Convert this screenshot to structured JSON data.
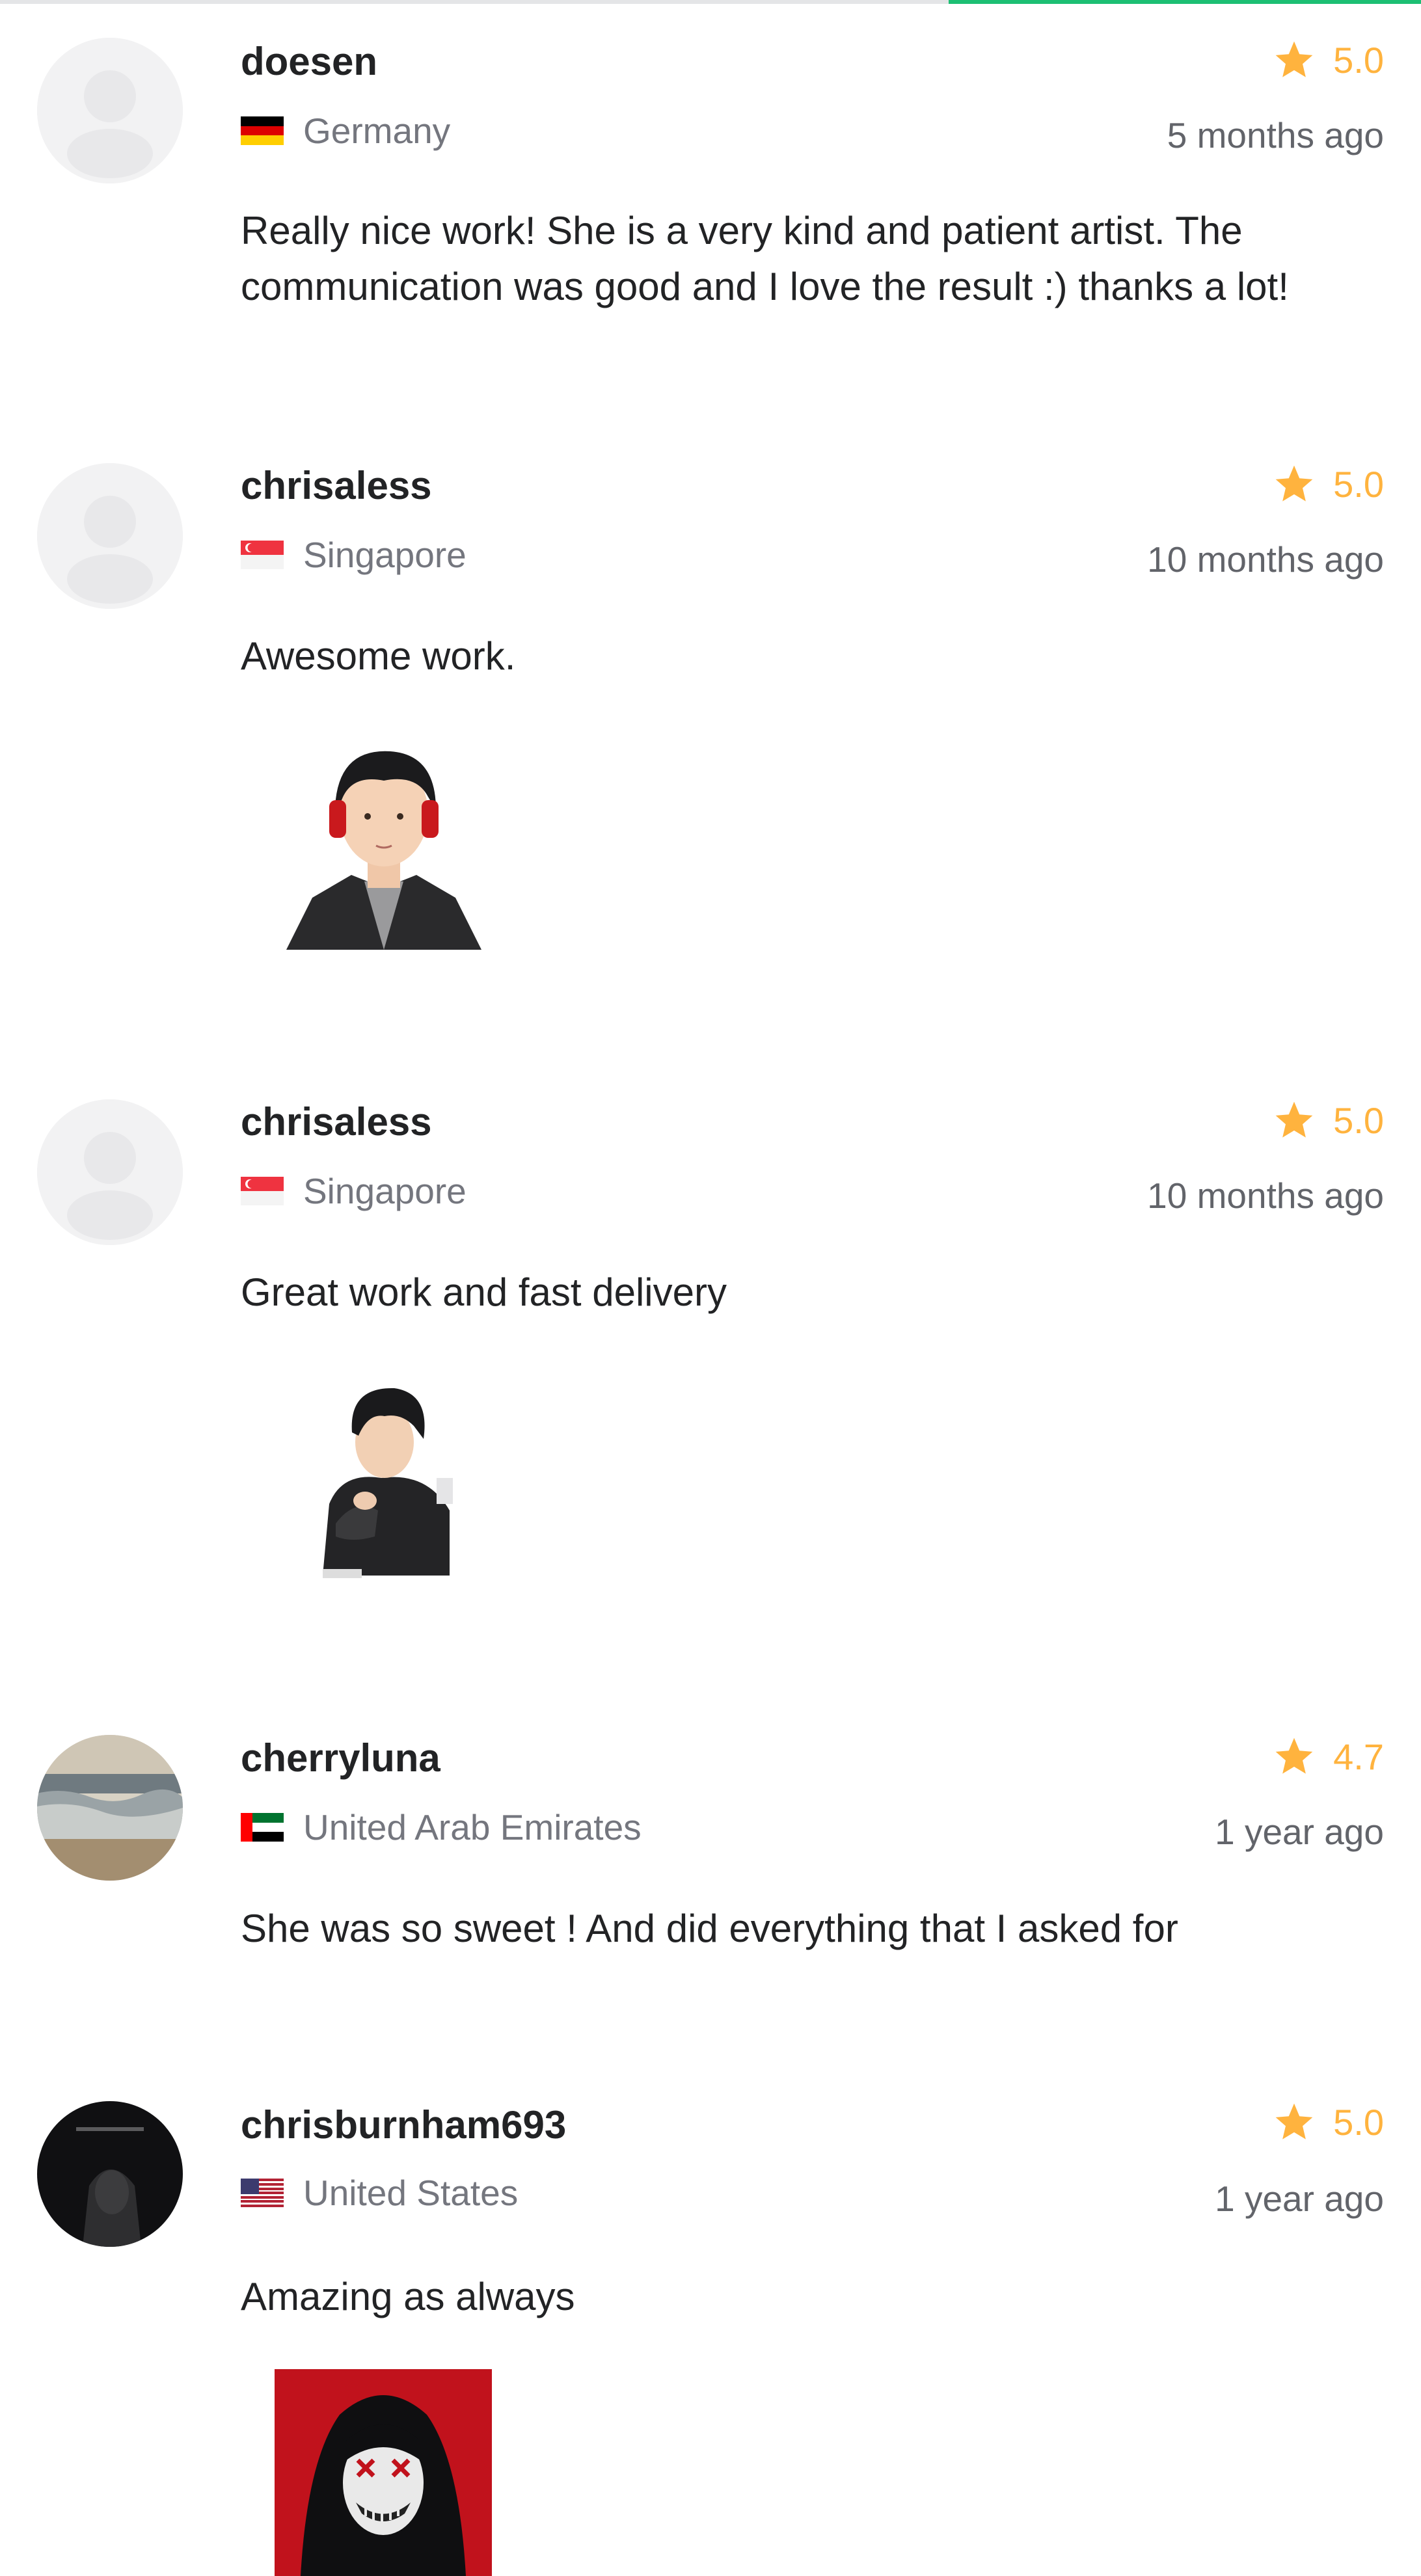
{
  "reviews": [
    {
      "username": "doesen",
      "country": "Germany",
      "flag": "germany-flag",
      "rating": "5.0",
      "time": "5 months ago",
      "text": "Really nice work! She is a very kind and patient artist. The communication was good and I love the result :) thanks a lot!",
      "avatar": "default-avatar"
    },
    {
      "username": "chrisaless",
      "country": "Singapore",
      "flag": "singapore-flag",
      "rating": "5.0",
      "time": "10 months ago",
      "text": "Awesome work.",
      "avatar": "default-avatar",
      "attachment": "portrait-man-headphones-illustration"
    },
    {
      "username": "chrisaless",
      "country": "Singapore",
      "flag": "singapore-flag",
      "rating": "5.0",
      "time": "10 months ago",
      "text": "Great work and fast delivery",
      "avatar": "default-avatar",
      "attachment": "portrait-man-sitting-illustration"
    },
    {
      "username": "cherryluna",
      "country": "United Arab Emirates",
      "flag": "uae-flag",
      "rating": "4.7",
      "time": "1 year ago",
      "text": "She was so sweet ! And did everything that I asked for",
      "avatar": "beach-photo-avatar"
    },
    {
      "username": "chrisburnham693",
      "country": "United States",
      "flag": "usa-flag",
      "rating": "5.0",
      "time": "1 year ago",
      "text": "Amazing as always",
      "avatar": "dark-figure-avatar",
      "attachment": "hooded-figure-red-background-illustration"
    }
  ],
  "colors": {
    "star": "#ffb33e",
    "accent": "#1dbf73",
    "muted_text": "#74767e"
  }
}
